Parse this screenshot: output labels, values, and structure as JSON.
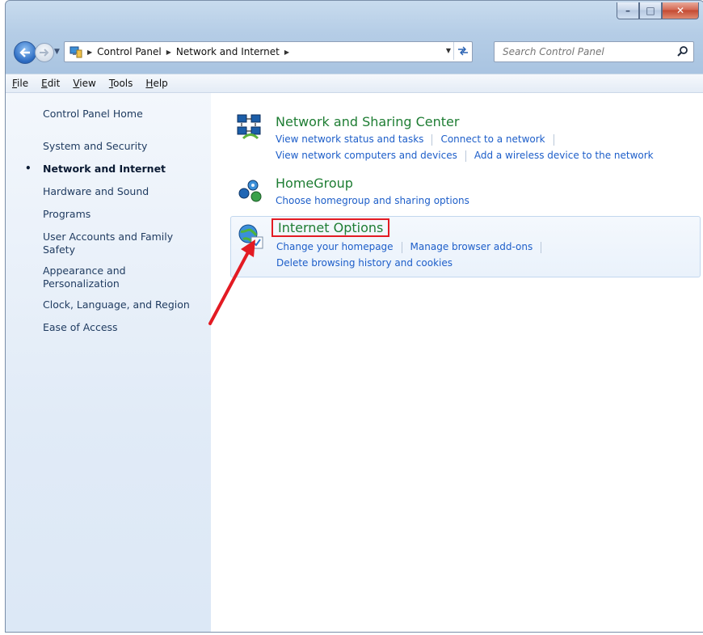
{
  "window": {
    "caption_buttons": {
      "minimize": "–",
      "maximize": "□",
      "close": "✕"
    }
  },
  "navigation": {
    "back_icon": "back-arrow-icon",
    "forward_icon": "forward-arrow-icon"
  },
  "address_bar": {
    "crumbs": [
      "Control Panel",
      "Network and Internet"
    ],
    "separator_icon": "chevron-right-icon"
  },
  "search": {
    "placeholder": "Search Control Panel"
  },
  "menu": {
    "items": [
      {
        "label": "File",
        "u": "F",
        "rest": "ile"
      },
      {
        "label": "Edit",
        "u": "E",
        "rest": "dit"
      },
      {
        "label": "View",
        "u": "V",
        "rest": "iew"
      },
      {
        "label": "Tools",
        "u": "T",
        "rest": "ools"
      },
      {
        "label": "Help",
        "u": "H",
        "rest": "elp"
      }
    ]
  },
  "sidebar": {
    "items": [
      {
        "label": "Control Panel Home"
      },
      {
        "label": "System and Security"
      },
      {
        "label": "Network and Internet",
        "active": true
      },
      {
        "label": "Hardware and Sound"
      },
      {
        "label": "Programs"
      },
      {
        "label": "User Accounts and Family Safety"
      },
      {
        "label": "Appearance and Personalization"
      },
      {
        "label": "Clock, Language, and Region"
      },
      {
        "label": "Ease of Access"
      }
    ],
    "bullet": "•"
  },
  "categories": [
    {
      "title": "Network and Sharing Center",
      "icon": "network-sharing-icon",
      "tasks": [
        [
          "View network status and tasks",
          "Connect to a network"
        ],
        [
          "View network computers and devices",
          "Add a wireless device to the network"
        ]
      ]
    },
    {
      "title": "HomeGroup",
      "icon": "homegroup-icon",
      "tasks": [
        [
          "Choose homegroup and sharing options"
        ]
      ]
    },
    {
      "title": "Internet Options",
      "icon": "internet-options-icon",
      "tasks": [
        [
          "Change your homepage",
          "Manage browser add-ons"
        ],
        [
          "Delete browsing history and cookies"
        ]
      ]
    }
  ],
  "colors": {
    "category_title": "#1e7d33",
    "link": "#1d5ec9",
    "highlight_box": "#e31b23"
  }
}
